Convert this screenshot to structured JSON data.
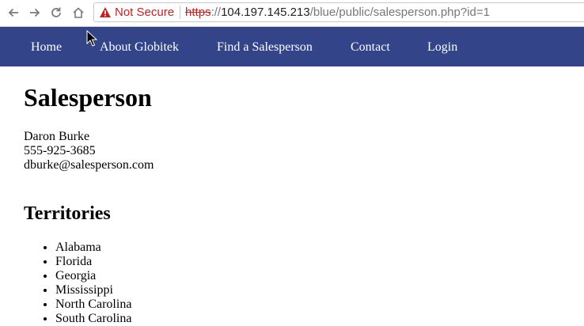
{
  "browser": {
    "security_label": "Not Secure",
    "url_scheme": "https",
    "url_separator": "://",
    "url_host": "104.197.145.213",
    "url_path": "/blue/public/salesperson.php?id=1"
  },
  "nav": {
    "items": [
      {
        "label": "Home"
      },
      {
        "label": "About Globitek"
      },
      {
        "label": "Find a Salesperson"
      },
      {
        "label": "Contact"
      },
      {
        "label": "Login"
      }
    ]
  },
  "page": {
    "title": "Salesperson",
    "contact": {
      "name": "Daron Burke",
      "phone": "555-925-3685",
      "email": "dburke@salesperson.com"
    },
    "territories_heading": "Territories",
    "territories": [
      "Alabama",
      "Florida",
      "Georgia",
      "Mississippi",
      "North Carolina",
      "South Carolina"
    ]
  },
  "colors": {
    "nav_background": "#334488",
    "security_warning": "#c5221f"
  }
}
